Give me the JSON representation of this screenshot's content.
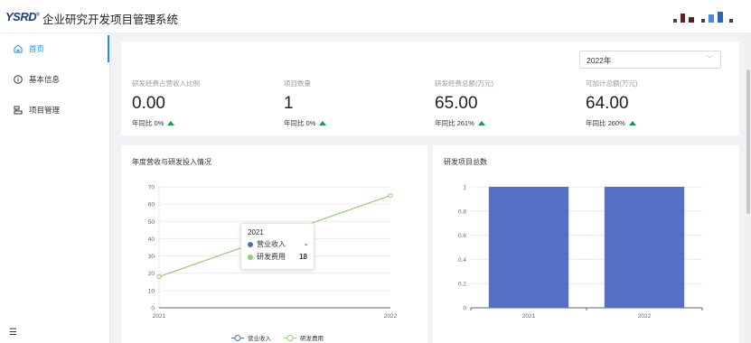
{
  "header": {
    "logo": "YSRD",
    "logo_mark": "®",
    "title": "企业研究开发项目管理系统"
  },
  "sidebar": {
    "items": [
      {
        "label": "首页",
        "icon": "home-icon",
        "active": true
      },
      {
        "label": "基本信息",
        "icon": "info-icon",
        "active": false
      },
      {
        "label": "项目管理",
        "icon": "project-icon",
        "active": false
      }
    ],
    "collapse_icon": "menu-icon"
  },
  "filter": {
    "year": "2022年"
  },
  "stats": [
    {
      "label": "研发经费占营收入比例",
      "value": "0.00",
      "yoy": "年同比 0%"
    },
    {
      "label": "项目数量",
      "value": "1",
      "yoy": "年同比 0%"
    },
    {
      "label": "研发经费总额(万元)",
      "value": "65.00",
      "yoy": "年同比 261%"
    },
    {
      "label": "可加计总额(万元)",
      "value": "64.00",
      "yoy": "年同比 260%"
    }
  ],
  "colors": {
    "primary": "#1890ff",
    "up": "#14a04b",
    "series_revenue": "#5470c6",
    "series_rd": "#91cc75",
    "bar": "#5470c6"
  },
  "chart_data": [
    {
      "type": "line",
      "title": "年度营收与研发投入情况",
      "x": [
        "2021",
        "2022"
      ],
      "series": [
        {
          "name": "营业收入",
          "values": [
            null,
            null
          ]
        },
        {
          "name": "研发费用",
          "values": [
            18,
            65
          ]
        }
      ],
      "ylim": [
        0,
        70
      ],
      "yticks": [
        "0",
        "10",
        "20",
        "30",
        "40",
        "50",
        "60",
        "70"
      ],
      "legend": "bottom",
      "grid": true,
      "tooltip": {
        "title": "2021",
        "rows": [
          {
            "name": "营业收入",
            "value": "-"
          },
          {
            "name": "研发费用",
            "value": "18"
          }
        ]
      }
    },
    {
      "type": "bar",
      "title": "研发项目总数",
      "categories": [
        "2021",
        "2022"
      ],
      "values": [
        1,
        1
      ],
      "ylim": [
        0,
        1
      ],
      "yticks": [
        "0",
        "0.2",
        "0.4",
        "0.6",
        "0.8",
        "1"
      ],
      "grid": true
    }
  ]
}
